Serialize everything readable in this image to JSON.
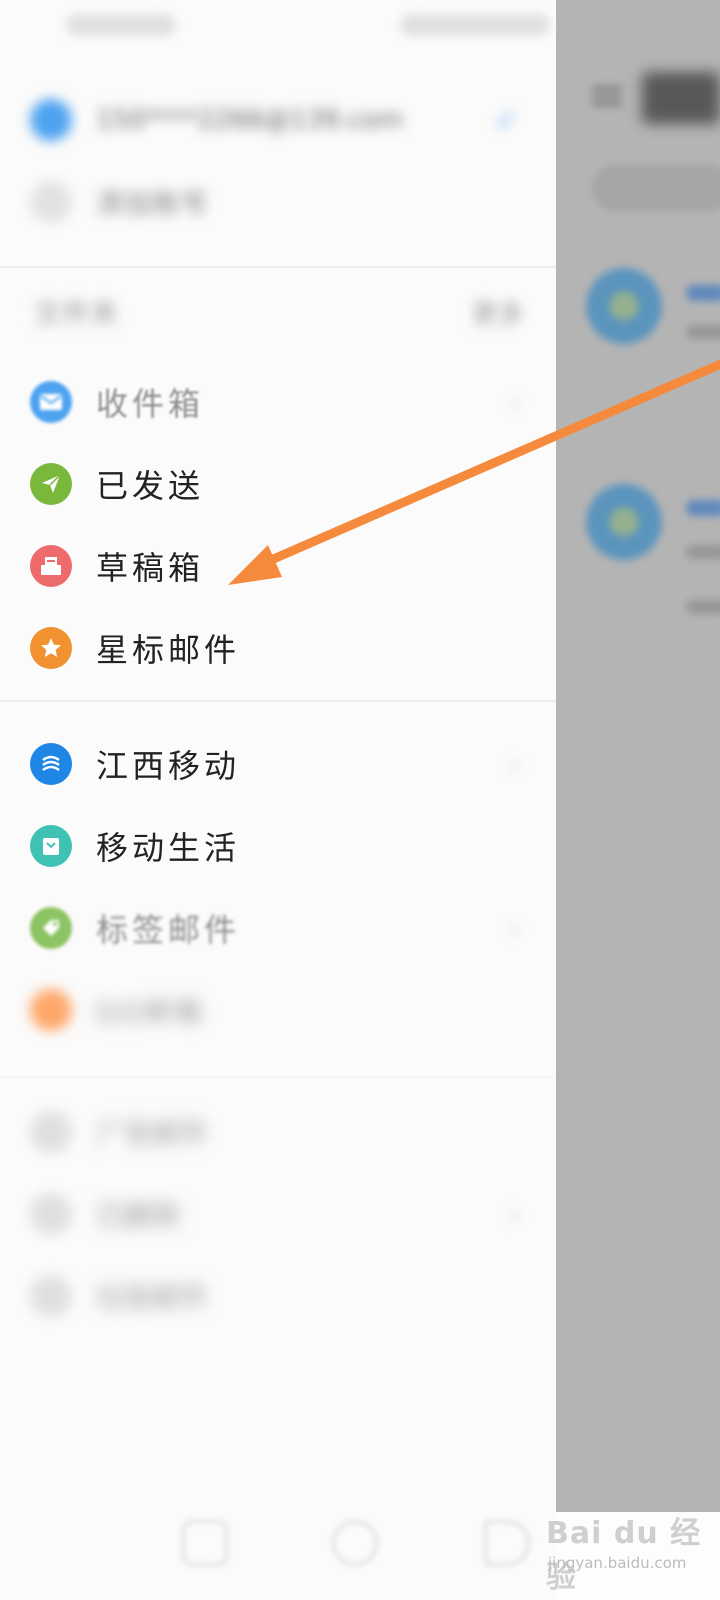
{
  "status_bar": {
    "left": "",
    "right": ""
  },
  "account": {
    "email": "150****2266@139.com",
    "add_account": "添加账号"
  },
  "folders_section": {
    "label": "文件夹",
    "manage": "更多"
  },
  "folders": [
    {
      "label": "收件箱",
      "icon": "envelope-icon",
      "color": "#4da3f0",
      "faded": true
    },
    {
      "label": "已发送",
      "icon": "send-icon",
      "color": "#79b83a",
      "faded": false
    },
    {
      "label": "草稿箱",
      "icon": "draft-icon",
      "color": "#ee6b6b",
      "faded": false
    },
    {
      "label": "星标邮件",
      "icon": "star-icon",
      "color": "#f2912f",
      "faded": false
    }
  ],
  "apps": [
    {
      "label": "江西移动",
      "icon": "china-mobile-icon",
      "color": "#1f86e6",
      "faded": false
    },
    {
      "label": "移动生活",
      "icon": "bag-icon",
      "color": "#3fc2b4",
      "faded": false
    },
    {
      "label": "标签邮件",
      "icon": "tag-icon",
      "color": "#8cc463",
      "faded": true
    },
    {
      "label": "QQ邮箱",
      "icon": "circle-icon",
      "color": "#ffa76a",
      "faded": true
    }
  ],
  "others": [
    {
      "label": "广告邮件"
    },
    {
      "label": "已删除"
    },
    {
      "label": "垃圾邮件"
    }
  ],
  "watermark": {
    "brand": "Bai du 经验",
    "sub": "jingyan.baidu.com"
  }
}
